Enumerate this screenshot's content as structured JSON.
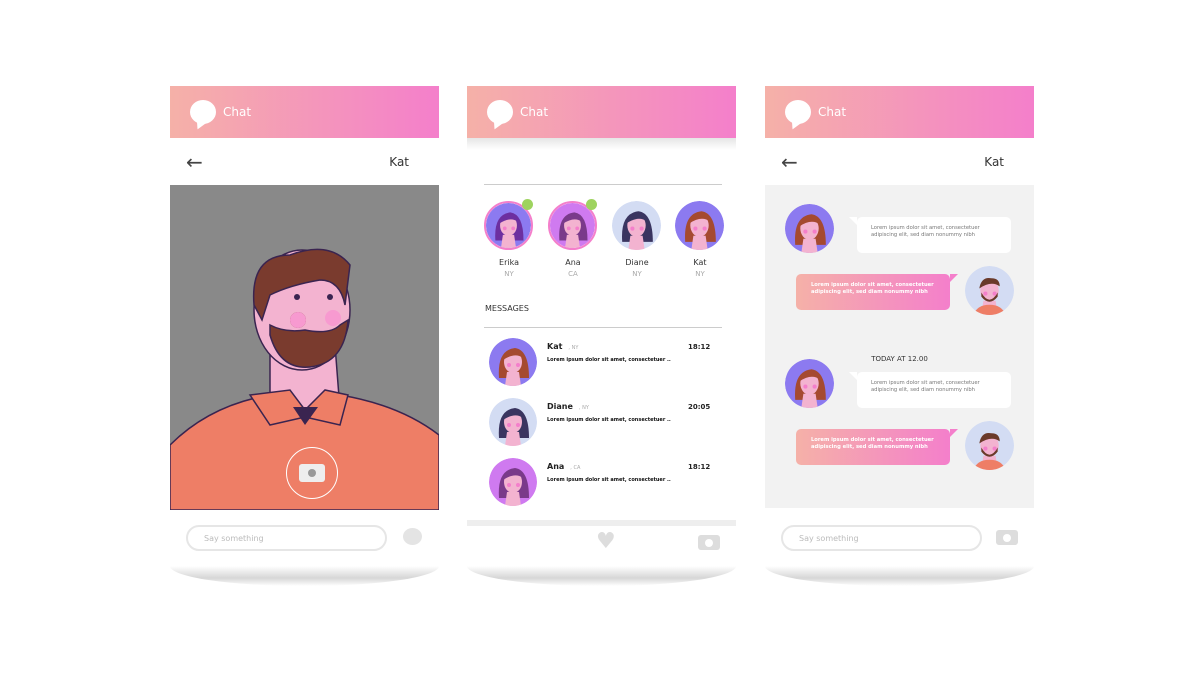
{
  "colors": {
    "header_start": "#f5b1a8",
    "header_end": "#f47fcb",
    "video_bg": "#898989",
    "chat_bg": "#f2f2f2",
    "online": "#9ed35f"
  },
  "app_title": "Chat",
  "phone1": {
    "contact": "Kat",
    "input_placeholder": "Say something",
    "icons": [
      "chat-bubble-icon",
      "back-arrow-icon",
      "camera-icon",
      "send-bubble-icon"
    ]
  },
  "phone2": {
    "stories": [
      {
        "name": "Erika",
        "loc": "NY",
        "online": true
      },
      {
        "name": "Ana",
        "loc": "CA",
        "online": true
      },
      {
        "name": "Diane",
        "loc": "NY",
        "online": false
      },
      {
        "name": "Kat",
        "loc": "NY",
        "online": false
      }
    ],
    "messages_label": "MESSAGES",
    "messages": [
      {
        "name": "Kat",
        "loc": ", NY",
        "time": "18:12",
        "text": "Lorem ipsum dolor sit amet, consectetuer .."
      },
      {
        "name": "Diane",
        "loc": ", NY",
        "time": "20:05",
        "text": "Lorem ipsum dolor sit amet, consectetuer .."
      },
      {
        "name": "Ana",
        "loc": ", CA",
        "time": "18:12",
        "text": "Lorem ipsum dolor sit amet, consectetuer .."
      }
    ],
    "icons": [
      "heart-icon",
      "camera-icon"
    ]
  },
  "phone3": {
    "contact": "Kat",
    "input_placeholder": "Say something",
    "divider": "TODAY AT 12.00",
    "chat": [
      {
        "from": "Kat",
        "text": "Lorem ipsum dolor sit amet, consectetuer adipiscing elit, sed diam nonummy nibh"
      },
      {
        "from": "me",
        "text": "Lorem ipsum dolor sit amet, consectetuer adipiscing elit, sed diam nonummy nibh"
      },
      {
        "from": "Kat",
        "text": "Lorem ipsum dolor sit amet, consectetuer adipiscing elit, sed diam nonummy nibh"
      },
      {
        "from": "me",
        "text": "Lorem ipsum dolor sit amet, consectetuer adipiscing elit, sed diam nonummy nibh"
      }
    ]
  }
}
